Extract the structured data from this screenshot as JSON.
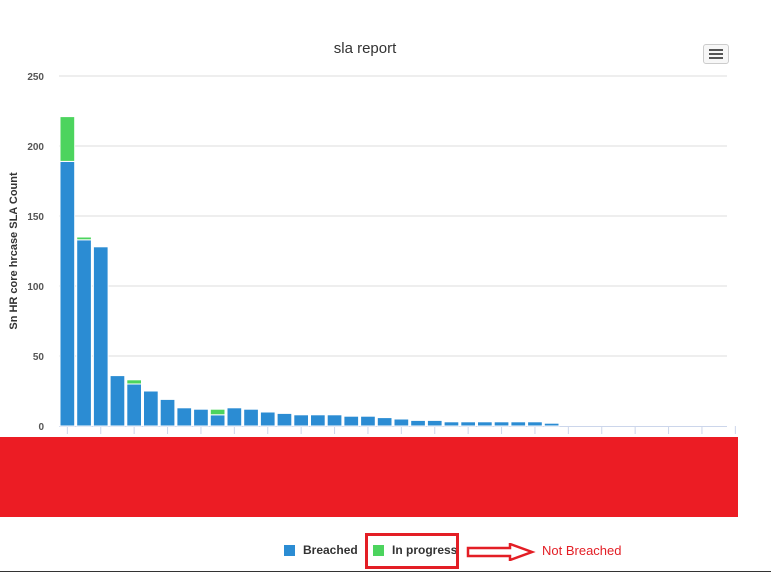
{
  "chart_data": {
    "type": "bar",
    "stacked": true,
    "title": "sla report",
    "xlabel": "",
    "ylabel": "Sn HR core hrcase SLA Count",
    "ylim": [
      0,
      250
    ],
    "yticks": [
      0,
      50,
      100,
      150,
      200,
      250
    ],
    "grid": true,
    "legend_position": "bottom",
    "category_count": 40,
    "series": [
      {
        "name": "Breached",
        "color": "#2b8cd3",
        "values": [
          189,
          133,
          128,
          36,
          30,
          25,
          19,
          13,
          12,
          8,
          13,
          12,
          10,
          9,
          8,
          8,
          8,
          7,
          7,
          6,
          5,
          4,
          4,
          3,
          3,
          3,
          3,
          3,
          3,
          2,
          0,
          0,
          0,
          0,
          0,
          0,
          0,
          0,
          0,
          0
        ]
      },
      {
        "name": "In progress",
        "color": "#4cd45e",
        "values": [
          32,
          2,
          0,
          0,
          3,
          0,
          0,
          0,
          0,
          4,
          0,
          0,
          0,
          0,
          0,
          0,
          0,
          0,
          0,
          0,
          0,
          0,
          0,
          0,
          0,
          0,
          0,
          0,
          0,
          0,
          0,
          0,
          0,
          0,
          0,
          0,
          0,
          0,
          0,
          0
        ]
      }
    ]
  },
  "annotation": {
    "text": "Not Breached",
    "color": "#e31e25"
  },
  "colors": {
    "redaction": "#ec1c24"
  }
}
